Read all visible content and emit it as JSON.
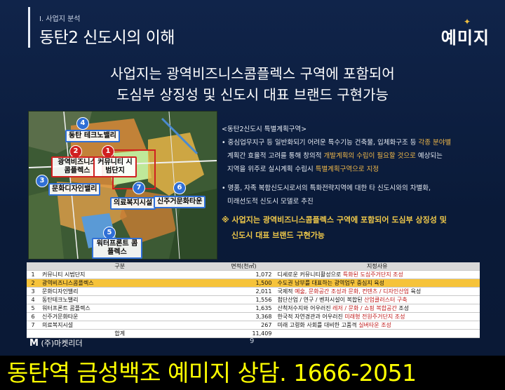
{
  "header": {
    "section_label": "Ⅰ. 사업지 분석",
    "title": "동탄2 신도시의 이해",
    "brand": "예미지"
  },
  "headline": {
    "line1": "사업지는 광역비즈니스콤플렉스 구역에 포함되어",
    "line2": "도심부 상징성 및 신도시 대표 브랜드 구현가능"
  },
  "map": {
    "labels": [
      {
        "num": "4",
        "text": "동탄 테크노밸리",
        "color": "blue"
      },
      {
        "num": "2",
        "text": "광역비즈니스 콤플렉스",
        "color": "red"
      },
      {
        "num": "1",
        "text": "커뮤니티 시범단지",
        "color": "red"
      },
      {
        "num": "3",
        "text": "문화디자인밸리",
        "color": "blue"
      },
      {
        "num": "7",
        "text": "의료복지시설",
        "color": "blue"
      },
      {
        "num": "6",
        "text": "신주거문화타운",
        "color": "blue"
      },
      {
        "num": "5",
        "text": "워터프론트 콤플렉스",
        "color": "blue"
      }
    ]
  },
  "info": {
    "heading": "<동탄2신도시 특별계획구역>",
    "b1_a": "중심업무지구 등 일반화되기 어려운 특수기능 건축물, 입체화구조 등 ",
    "b1_hl1": "각종 분야별",
    "b1_b": "계획간 효율적 고려를 통해 창의적 ",
    "b1_hl2": "개발계획의 수립이 필요할 것으로",
    "b1_c": " 예상되는",
    "b1_d": "지역을 위주로 실시계획 수립시 ",
    "b1_hl3": "특별계획구역으로 지정",
    "b2_a": "명품, 자족 복합신도시로서의 특화전략지역에 대한 타 신도시와의 차별화,",
    "b2_b": "미래선도적 신도시 모델로 추진",
    "note_1": "※ 사업지는 광역비즈니스콤플렉스 구역에 포함되어 도심부 상징성 및",
    "note_2": "신도시 대표 브랜드 구현가능"
  },
  "table": {
    "headers": [
      "구분",
      "면적(천㎡)",
      "지정사유"
    ],
    "rows": [
      {
        "idx": "1",
        "name": "커뮤니티 시범단지",
        "area": "1,072",
        "reason_a": "디세로운 커뮤니티활성으로 ",
        "reason_hl": "특화된 도심주거단지 조성",
        "reason_b": ""
      },
      {
        "idx": "2",
        "name": "광역비즈니스콤플렉스",
        "area": "1,500",
        "reason_a": "수도권 남부를 대표하는 광역업무 중심지 육성",
        "reason_hl": "",
        "reason_b": ""
      },
      {
        "idx": "3",
        "name": "문화디자인밸리",
        "area": "2,011",
        "reason_a": "국제적 ",
        "reason_hl": "예술, 문화공간 조성과 문화, 컨텐츠 / 디자인산업",
        "reason_b": " 육성"
      },
      {
        "idx": "4",
        "name": "동탄테크노밸리",
        "area": "1,556",
        "reason_a": "첨단산업 / 연구 / 벤처시설이 복합된 ",
        "reason_hl": "산업클러스터 구축",
        "reason_b": ""
      },
      {
        "idx": "5",
        "name": "워터프론트 콤플렉스",
        "area": "1,635",
        "reason_a": "산척저수지와 어우러진 ",
        "reason_hl": "레저 / 문화 / 쇼핑 복합공간",
        "reason_b": " 조성"
      },
      {
        "idx": "6",
        "name": "신주거문화타운",
        "area": "3,368",
        "reason_a": "한국적 자연경관과 어우러진 ",
        "reason_hl": "미래형 전원주거단지 조성",
        "reason_b": ""
      },
      {
        "idx": "7",
        "name": "의료복지시설",
        "area": "267",
        "reason_a": "미래 고령화 사회를 대비한 고품격 ",
        "reason_hl": "실버타운 조성",
        "reason_b": ""
      }
    ],
    "total_label": "합계",
    "total_area": "11,409"
  },
  "footer": {
    "logo": "(주)마켓리더",
    "page": "9"
  },
  "banner": {
    "text": "동탄역 금성백조 예미지 상담.   1666-2051"
  },
  "colors": {
    "banner_text": "#ffff00",
    "highlight_row": "#f6c33a",
    "accent_orange": "#f0b84a"
  }
}
